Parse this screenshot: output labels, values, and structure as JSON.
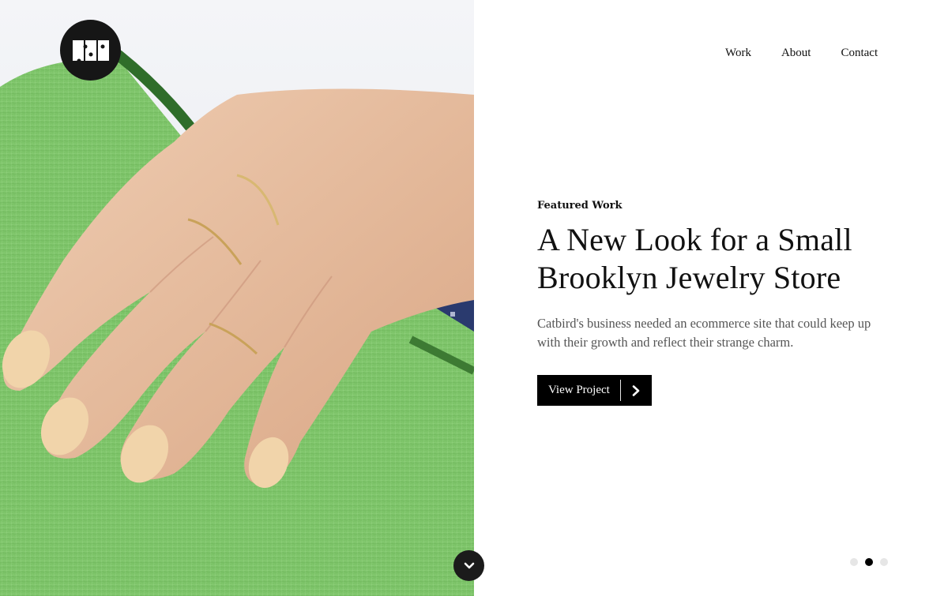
{
  "header": {
    "logo_alt": "Studio logo"
  },
  "nav": {
    "items": [
      {
        "label": "Work"
      },
      {
        "label": "About"
      },
      {
        "label": "Contact"
      }
    ]
  },
  "featured": {
    "eyebrow": "Featured Work",
    "headline_line1": "A New Look for a Small",
    "headline_line2": "Brooklyn Jewelry Store",
    "description": "Catbird's business needed an ecommerce site that could keep up with their growth and reflect their strange charm.",
    "cta_label": "View Project",
    "cta_icon": "chevron-right-icon"
  },
  "slider": {
    "total_slides": 3,
    "active_index": 1
  },
  "hero": {
    "image_subject": "hand-with-gold-rings-on-green-leather-bag",
    "scroll_icon": "chevron-down-icon"
  },
  "colors": {
    "accent": "#000000",
    "text": "#111111",
    "muted_text": "#555555",
    "bag_green": "#7cc368",
    "skin": "#e7bfa2",
    "nail": "#f1d4aa"
  }
}
